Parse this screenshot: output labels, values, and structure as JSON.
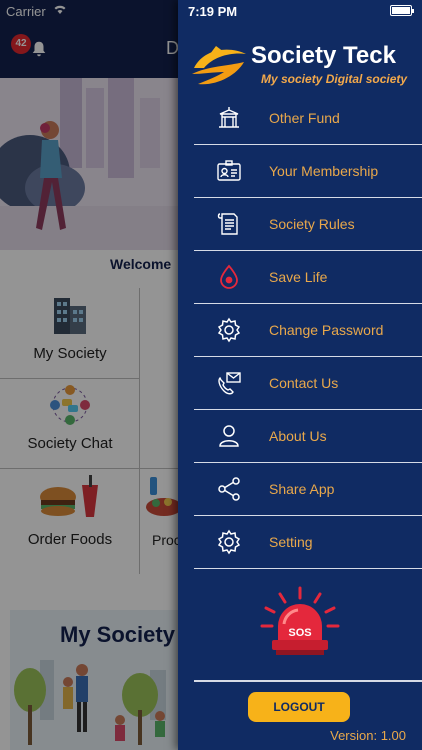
{
  "status_bar": {
    "carrier": "Carrier",
    "time": "7:19 PM"
  },
  "background_app": {
    "notification_count": "42",
    "title_initial": "D",
    "welcome_text": "Welcome",
    "tiles": [
      {
        "label": "My Society",
        "icon": "building-icon"
      },
      {
        "label": "Society Chat",
        "icon": "chat-group-icon"
      },
      {
        "label": "Order Foods",
        "icon": "food-icon"
      },
      {
        "label": "Proc",
        "icon": "grocery-icon"
      }
    ],
    "promo_title": "My Society"
  },
  "drawer": {
    "brand": {
      "name": "Society Teck",
      "tagline": "My society Digital society"
    },
    "menu": [
      {
        "label": "Other Fund",
        "icon": "temple-icon"
      },
      {
        "label": "Your Membership",
        "icon": "id-card-icon"
      },
      {
        "label": "Society Rules",
        "icon": "document-icon"
      },
      {
        "label": "Save Life",
        "icon": "blood-drop-icon"
      },
      {
        "label": "Change Password",
        "icon": "gear-icon"
      },
      {
        "label": "Contact Us",
        "icon": "contact-icon"
      },
      {
        "label": "About Us",
        "icon": "person-icon"
      },
      {
        "label": "Share App",
        "icon": "share-icon"
      },
      {
        "label": "Setting",
        "icon": "settings-icon"
      }
    ],
    "sos_label": "SOS",
    "logout_label": "LOGOUT",
    "version": "Version: 1.00"
  },
  "colors": {
    "drawer_bg": "#102b63",
    "menu_text": "#e9a84b",
    "logout_bg": "#f7b219",
    "tagline": "#f3a94b"
  }
}
